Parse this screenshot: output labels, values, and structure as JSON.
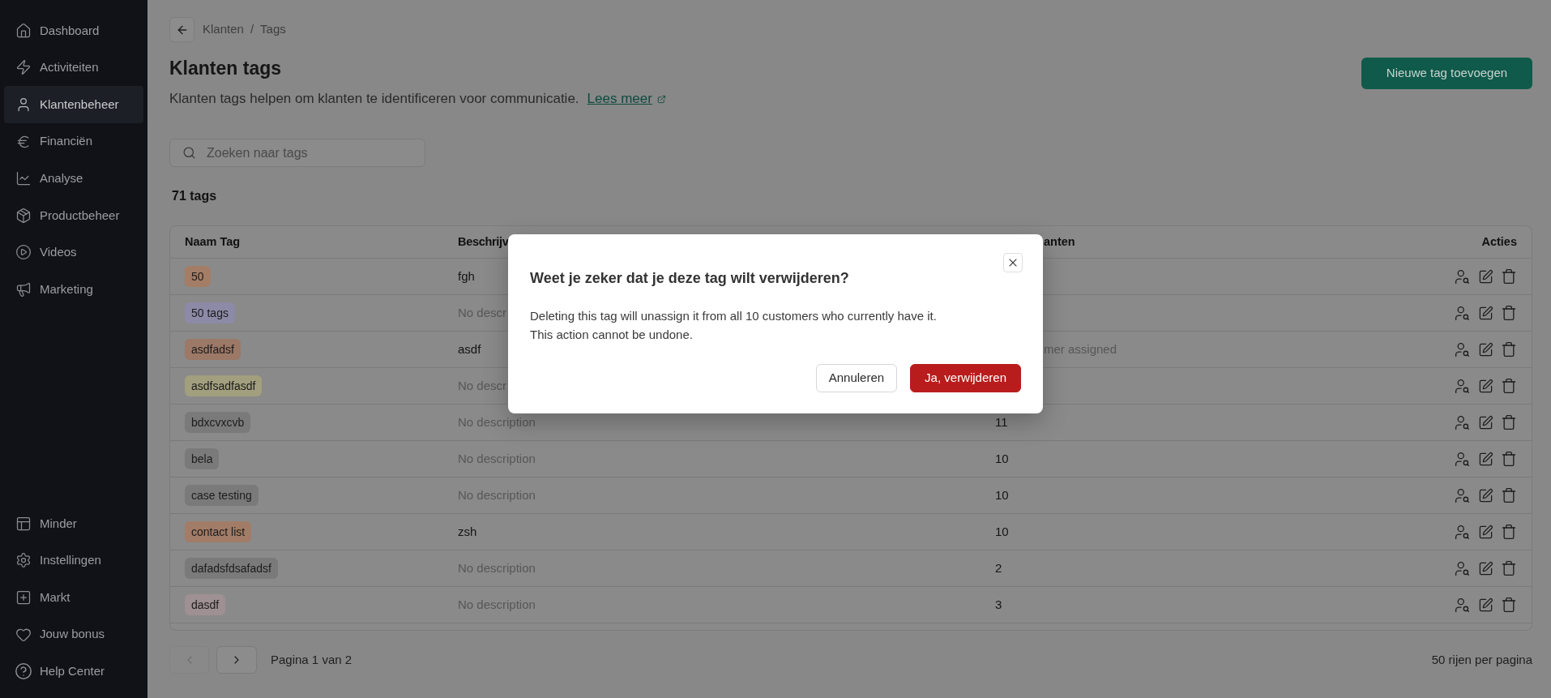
{
  "sidebar": {
    "items": [
      {
        "label": "Dashboard",
        "selected": false
      },
      {
        "label": "Activiteiten",
        "selected": false
      },
      {
        "label": "Klantenbeheer",
        "selected": true
      },
      {
        "label": "Financiën",
        "selected": false
      },
      {
        "label": "Analyse",
        "selected": false
      },
      {
        "label": "Productbeheer",
        "selected": false
      },
      {
        "label": "Videos",
        "selected": false
      },
      {
        "label": "Marketing",
        "selected": false
      }
    ],
    "footer_items": [
      {
        "label": "Minder",
        "selected": false
      },
      {
        "label": "Instellingen",
        "selected": false
      },
      {
        "label": "Markt",
        "selected": false
      },
      {
        "label": "Jouw bonus",
        "selected": false
      },
      {
        "label": "Help Center",
        "selected": false
      }
    ]
  },
  "breadcrumb": {
    "items": [
      "Klanten",
      "Tags"
    ],
    "separator": "/"
  },
  "header": {
    "title": "Klanten tags",
    "description": "Klanten tags helpen om klanten te identificeren voor communicatie.",
    "link": "Lees meer",
    "button": "Nieuwe tag toevoegen"
  },
  "search": {
    "placeholder": "Zoeken naar tags"
  },
  "tag_count": "71 tags",
  "table": {
    "columns": [
      "Naam Tag",
      "Beschrijv",
      "anten",
      "Acties"
    ],
    "rows": [
      {
        "tag": {
          "label": "50",
          "color": "#a47d66"
        },
        "description": {
          "text": "fgh",
          "muted": false
        }
      },
      {
        "tag": {
          "label": "50 tags",
          "color": "#8d8aa8"
        },
        "description": {
          "text": "No descr",
          "muted": true
        }
      },
      {
        "tag": {
          "label": "asdfadsf",
          "color": "#9c7866"
        },
        "description": {
          "text": "asdf",
          "muted": false
        },
        "column_3": {
          "text": "mer assigned",
          "muted": true
        }
      },
      {
        "tag": {
          "label": "asdfsadfasdf",
          "color": "#a29f7e"
        },
        "description": {
          "text": "No descr",
          "muted": true
        }
      },
      {
        "tag": {
          "label": "bdxcvxcvb",
          "color": "#7a7a7a"
        },
        "description": {
          "text": "No description",
          "muted": true
        },
        "column_3": {
          "text": "11",
          "muted": false
        }
      },
      {
        "tag": {
          "label": "bela",
          "color": "#7a7a7a"
        },
        "description": {
          "text": "No description",
          "muted": true
        },
        "column_3": {
          "text": "10",
          "muted": false
        }
      },
      {
        "tag": {
          "label": "case testing",
          "color": "#7a7a7a"
        },
        "description": {
          "text": "No description",
          "muted": true
        },
        "column_3": {
          "text": "10",
          "muted": false
        }
      },
      {
        "tag": {
          "label": "contact list",
          "color": "#a27c67"
        },
        "description": {
          "text": "zsh",
          "muted": false
        },
        "column_3": {
          "text": "10",
          "muted": false
        }
      },
      {
        "tag": {
          "label": "dafadsfdsafadsf",
          "color": "#7a7a7a"
        },
        "description": {
          "text": "No description",
          "muted": true
        },
        "column_3": {
          "text": "2",
          "muted": false
        }
      },
      {
        "tag": {
          "label": "dasdf",
          "color": "#9e9093"
        },
        "description": {
          "text": "No description",
          "muted": true
        },
        "column_3": {
          "text": "3",
          "muted": false
        }
      }
    ]
  },
  "pagination": {
    "previous": {
      "disabled": true
    },
    "next": {
      "disabled": false
    },
    "page": "Pagina 1 van 2",
    "rows_per_page": "50 rijen per pagina"
  },
  "dialog": {
    "title": "Weet je zeker dat je deze tag wilt verwijderen?",
    "lines": [
      "Deleting this tag will unassign it from all 10 customers who currently have it.",
      "This action cannot be undone."
    ],
    "buttons": [
      {
        "label": "Annuleren",
        "kind": "secondary"
      },
      {
        "label": "Ja, verwijderen",
        "kind": "danger"
      }
    ]
  }
}
